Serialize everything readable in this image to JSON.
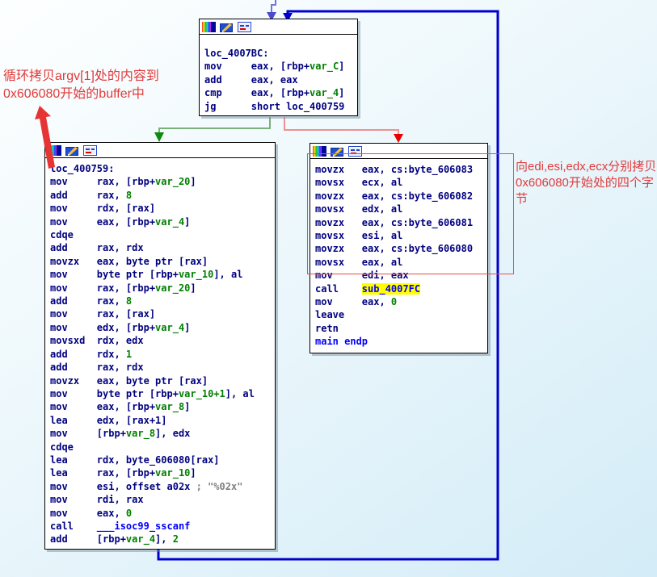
{
  "annotations": {
    "left_line1": "循环拷贝argv[1]处的内容到",
    "left_line2": "0x606080开始的buffer中",
    "right_text": "向edi,esi,edx,ecx分别拷贝0x606080开始处的四个字节"
  },
  "colors": {
    "code_default": "#000080",
    "code_operand_green": "#008000",
    "code_name_blue": "#0000ff",
    "code_comment_gray": "#808080",
    "highlight_bg": "#ffff00",
    "edge_loop_blue": "#0000cc",
    "edge_incoming_blue": "#7373d9",
    "edge_true_green": "#7ab17a",
    "edge_true_arrow": "#0e8a0e",
    "edge_false_red": "#f09090",
    "edge_false_arrow": "#e60000",
    "annotation_red": "#e13a3a"
  },
  "icons": [
    "node-color-icon",
    "node-edit-icon",
    "node-frame-icon"
  ],
  "blocks": [
    {
      "label": "loc_4007BC",
      "lines": [
        [
          [
            "n",
            "loc_4007BC:"
          ]
        ],
        [
          [
            "n",
            "mov     eax, [rbp+"
          ],
          [
            "g",
            "var_C"
          ],
          [
            "n",
            "]"
          ]
        ],
        [
          [
            "n",
            "add     eax, eax"
          ]
        ],
        [
          [
            "n",
            "cmp     eax, [rbp+"
          ],
          [
            "g",
            "var_4"
          ],
          [
            "n",
            "]"
          ]
        ],
        [
          [
            "n",
            "jg      short loc_400759"
          ]
        ]
      ]
    },
    {
      "label": "loc_400759",
      "lines": [
        [
          [
            "n",
            "loc_400759:"
          ]
        ],
        [
          [
            "n",
            "mov     rax, [rbp+"
          ],
          [
            "g",
            "var_20"
          ],
          [
            "n",
            "]"
          ]
        ],
        [
          [
            "n",
            "add     rax, "
          ],
          [
            "g",
            "8"
          ]
        ],
        [
          [
            "n",
            "mov     rdx, [rax]"
          ]
        ],
        [
          [
            "n",
            "mov     eax, [rbp+"
          ],
          [
            "g",
            "var_4"
          ],
          [
            "n",
            "]"
          ]
        ],
        [
          [
            "n",
            "cdqe"
          ]
        ],
        [
          [
            "n",
            "add     rax, rdx"
          ]
        ],
        [
          [
            "n",
            "movzx   eax, byte ptr [rax]"
          ]
        ],
        [
          [
            "n",
            "mov     byte ptr [rbp+"
          ],
          [
            "g",
            "var_10"
          ],
          [
            "n",
            "], al"
          ]
        ],
        [
          [
            "n",
            "mov     rax, [rbp+"
          ],
          [
            "g",
            "var_20"
          ],
          [
            "n",
            "]"
          ]
        ],
        [
          [
            "n",
            "add     rax, "
          ],
          [
            "g",
            "8"
          ]
        ],
        [
          [
            "n",
            "mov     rax, [rax]"
          ]
        ],
        [
          [
            "n",
            "mov     edx, [rbp+"
          ],
          [
            "g",
            "var_4"
          ],
          [
            "n",
            "]"
          ]
        ],
        [
          [
            "n",
            "movsxd  rdx, edx"
          ]
        ],
        [
          [
            "n",
            "add     rdx, "
          ],
          [
            "g",
            "1"
          ]
        ],
        [
          [
            "n",
            "add     rax, rdx"
          ]
        ],
        [
          [
            "n",
            "movzx   eax, byte ptr [rax]"
          ]
        ],
        [
          [
            "n",
            "mov     byte ptr [rbp+"
          ],
          [
            "g",
            "var_10+1"
          ],
          [
            "n",
            "], al"
          ]
        ],
        [
          [
            "n",
            "mov     eax, [rbp+"
          ],
          [
            "g",
            "var_8"
          ],
          [
            "n",
            "]"
          ]
        ],
        [
          [
            "n",
            "lea     edx, [rax+1]"
          ]
        ],
        [
          [
            "n",
            "mov     [rbp+"
          ],
          [
            "g",
            "var_8"
          ],
          [
            "n",
            "], edx"
          ]
        ],
        [
          [
            "n",
            "cdqe"
          ]
        ],
        [
          [
            "n",
            "lea     rdx, byte_606080[rax]"
          ]
        ],
        [
          [
            "n",
            "lea     rax, [rbp+"
          ],
          [
            "g",
            "var_10"
          ],
          [
            "n",
            "]"
          ]
        ],
        [
          [
            "n",
            "mov     esi, offset a02x "
          ],
          [
            "c",
            "; \"%02x\""
          ]
        ],
        [
          [
            "n",
            "mov     rdi, rax"
          ]
        ],
        [
          [
            "n",
            "mov     eax, "
          ],
          [
            "g",
            "0"
          ]
        ],
        [
          [
            "n",
            "call    "
          ],
          [
            "b",
            "___isoc99_sscanf"
          ]
        ],
        [
          [
            "n",
            "add     [rbp+"
          ],
          [
            "g",
            "var_4"
          ],
          [
            "n",
            "], "
          ],
          [
            "g",
            "2"
          ]
        ]
      ]
    },
    {
      "label": "main_end",
      "lines": [
        [
          [
            "n",
            "movzx   eax, cs:byte_606083"
          ]
        ],
        [
          [
            "n",
            "movsx   ecx, al"
          ]
        ],
        [
          [
            "n",
            "movzx   eax, cs:byte_606082"
          ]
        ],
        [
          [
            "n",
            "movsx   edx, al"
          ]
        ],
        [
          [
            "n",
            "movzx   eax, cs:byte_606081"
          ]
        ],
        [
          [
            "n",
            "movsx   esi, al"
          ]
        ],
        [
          [
            "n",
            "movzx   eax, cs:byte_606080"
          ]
        ],
        [
          [
            "n",
            "movsx   eax, al"
          ]
        ],
        [
          [
            "n",
            "mov     edi, eax"
          ]
        ],
        [
          [
            "n",
            "call    "
          ],
          [
            "hl",
            "sub_4007FC"
          ]
        ],
        [
          [
            "n",
            "mov     eax, "
          ],
          [
            "g",
            "0"
          ]
        ],
        [
          [
            "n",
            "leave"
          ]
        ],
        [
          [
            "n",
            "retn"
          ]
        ],
        [
          [
            "b",
            "main endp"
          ]
        ]
      ]
    }
  ]
}
